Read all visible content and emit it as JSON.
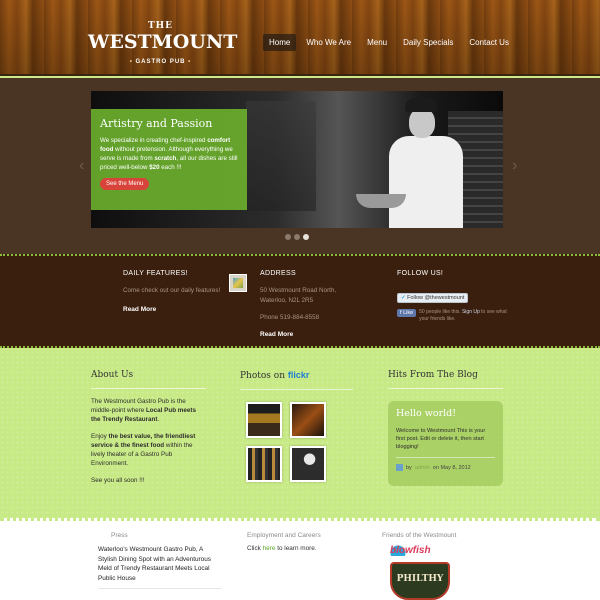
{
  "header": {
    "logo": {
      "the": "THE",
      "name": "WESTMOUNT",
      "sub_left": "•",
      "sub": "GASTRO PUB",
      "sub_right": "•"
    },
    "nav": [
      {
        "label": "Home",
        "active": true
      },
      {
        "label": "Who We Are"
      },
      {
        "label": "Menu"
      },
      {
        "label": "Daily Specials"
      },
      {
        "label": "Contact Us"
      }
    ]
  },
  "slider": {
    "title": "Artistry and Passion",
    "text_1": "We specialize in creating chef-inspired ",
    "text_bold_1": "comfort food",
    "text_2": " without pretension. Although everything we serve is made from ",
    "text_bold_2": "scratch",
    "text_3": ", all our dishes are still priced well-below ",
    "text_bold_3": "$20",
    "text_4": " each !!!",
    "button": "See the Menu",
    "prev_arrow": "‹",
    "next_arrow": "›",
    "active_slide": 3,
    "slide_count": 3
  },
  "features": {
    "daily": {
      "title": "DAILY FEATURES!",
      "text": "Come check out our daily features!",
      "more": "Read More"
    },
    "address": {
      "title": "ADDRESS",
      "line1": "50 Westmount Road North,",
      "line2": "Waterloo, N2L 2R5",
      "phone": "Phone 519-884-8558",
      "more": "Read More"
    },
    "follow": {
      "title": "FOLLOW US!",
      "twitter": "Follow @thewestmount",
      "fb_like": "Like",
      "fb_text_1": "50 people like this. ",
      "fb_signup": "Sign Up",
      "fb_text_2": " to see what your friends like."
    }
  },
  "main": {
    "about": {
      "title": "About Us",
      "p1_a": "The Westmount Gastro Pub is the middle-point where ",
      "p1_b": "Local Pub meets the Trendy Restaurant",
      "p1_c": ".",
      "p2_a": "Enjoy ",
      "p2_b": "the best value, the friendliest service & the finest food",
      "p2_c": " within the lively theater of a Gastro Pub Environment.",
      "p3": "See you all soon !!!"
    },
    "photos": {
      "title": "Photos on ",
      "brand": "flickr"
    },
    "blog": {
      "title": "Hits From The Blog",
      "post_title": "Hello world!",
      "post_text": "Welcome to Westmount This is your first post. Edit or delete it, then start blogging!",
      "by": "by",
      "author": "admin",
      "date": "on May 8, 2012"
    }
  },
  "footer": {
    "press": {
      "title": "Press",
      "item1": "Waterloo's Westmount Gastro Pub, A Stylish Dining Spot with an Adventurous Meld of Trendy Restaurant Meets Local Public House"
    },
    "careers": {
      "title": "Employment and Careers",
      "text_a": "Click ",
      "link": "here",
      "text_b": " to learn more."
    },
    "friends": {
      "title": "Friends of the Westmount",
      "friend1": "blowfish",
      "friend2": "PHILTHY"
    }
  }
}
